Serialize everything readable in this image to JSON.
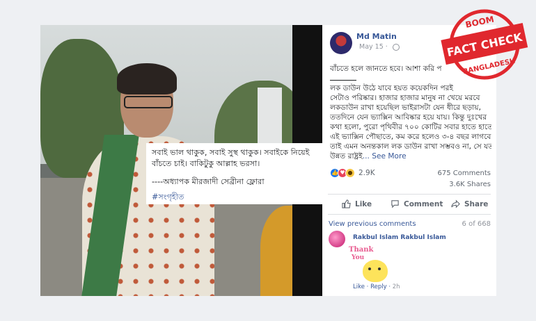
{
  "photo": {
    "caption": {
      "line1": "সবাই ভাল থাকুক, সবাই সুস্থ থাকুক। সবাইকে নিয়েই",
      "line2": "বাঁচতে চাই। বাকিটুকু আল্লাহ ভরসা।",
      "author": "----অধ্যাপক মীরজাদী সেব্রীনা ফ্লোরা",
      "tag": "#সংগৃহীত"
    }
  },
  "post": {
    "author": "Md Matin",
    "date": "May 15 ·",
    "lines": [
      "বাঁচতে হলে জানতে হবে। আশা করি প",
      "লক ডাউন উঠে যাবে হয়ত কয়েকদিন পরই",
      "সেটাও পরিষ্কার। হাজার হাজার মানুষ না খেয়ে মরবে",
      "লকডাউন রাখা হয়েছিল ভাইরাসটা যেন ধীরে ছড়ায়,",
      "ততদিনে যেন ভ্যাক্সিন আবিষ্কার হয়ে যায়। কিন্তু দুঃখের",
      "কথা হলো, পুরো পৃথিবীর ৭০০ কোটির সবার হাতে হাতে",
      "এই ভ্যাক্সিন পৌছাতে, কম করে হলেও ৩-৪ বছর লাগবে।",
      "তাই এমন অনন্তকাল লক ডাউন রাখা সম্ভবও না, সে যত",
      "উন্নত রাষ্ট্রই"
    ],
    "see_more": "... See More",
    "reaction_count": "2.9K",
    "comments": "675 Comments",
    "shares": "3.6K Shares",
    "actions": {
      "like": "Like",
      "comment": "Comment",
      "share": "Share"
    },
    "view_previous": "View previous comments",
    "comment_count": "6 of 668",
    "comment": {
      "author": "Rakbul Islam Rakbul Islam",
      "sticker_line1": "Thank",
      "sticker_line2": "You",
      "like": "Like",
      "reply": "Reply",
      "time": "2h"
    }
  },
  "stamp": {
    "top": "BOOM",
    "main": "FACT CHECK",
    "bottom": "BANGLADESH",
    "color": "#e0282e"
  }
}
